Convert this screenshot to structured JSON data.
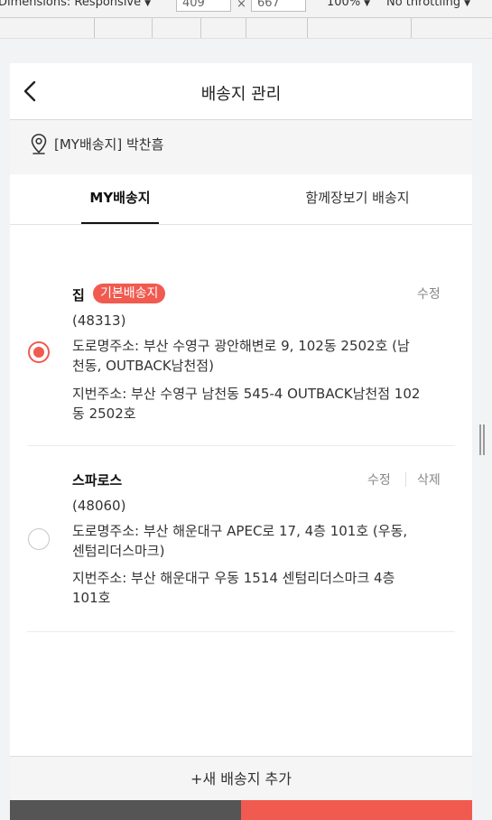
{
  "devtools": {
    "dimensions_label": "Dimensions: Responsive",
    "width_value": "409",
    "times": "×",
    "height_value": "667",
    "zoom": "100%",
    "throttle": "No throttling"
  },
  "header": {
    "title": "배송지 관리"
  },
  "current": {
    "text": "[MY배송지] 박찬흠"
  },
  "tabs": [
    {
      "label": "MY배송지",
      "active": true
    },
    {
      "label": "함께장보기 배송지",
      "active": false
    }
  ],
  "addresses": [
    {
      "name": "집",
      "badge": "기본배송지",
      "selected": true,
      "edit_label": "수정",
      "postcode": "(48313)",
      "road_lines": [
        "도로명주소: 부산 수영구 광안해변로 9, 102동 2502호 (남",
        "천동, OUTBACK남천점)"
      ],
      "jibun_lines": [
        "지번주소: 부산 수영구 남천동 545-4 OUTBACK남천점 102",
        "동 2502호"
      ]
    },
    {
      "name": "스파로스",
      "selected": false,
      "edit_label": "수정",
      "delete_label": "삭제",
      "postcode": "(48060)",
      "road_lines": [
        "도로명주소: 부산 해운대구 APEC로 17, 4층 101호 (우동,",
        "센텀리더스마크)"
      ],
      "jibun_lines": [
        "지번주소: 부산 해운대구 우동 1514 센텀리더스마크 4층",
        "101호"
      ]
    }
  ],
  "add_button": "+새 배송지 추가",
  "colors": {
    "accent": "#f15a4f",
    "dark_button": "#555555"
  }
}
